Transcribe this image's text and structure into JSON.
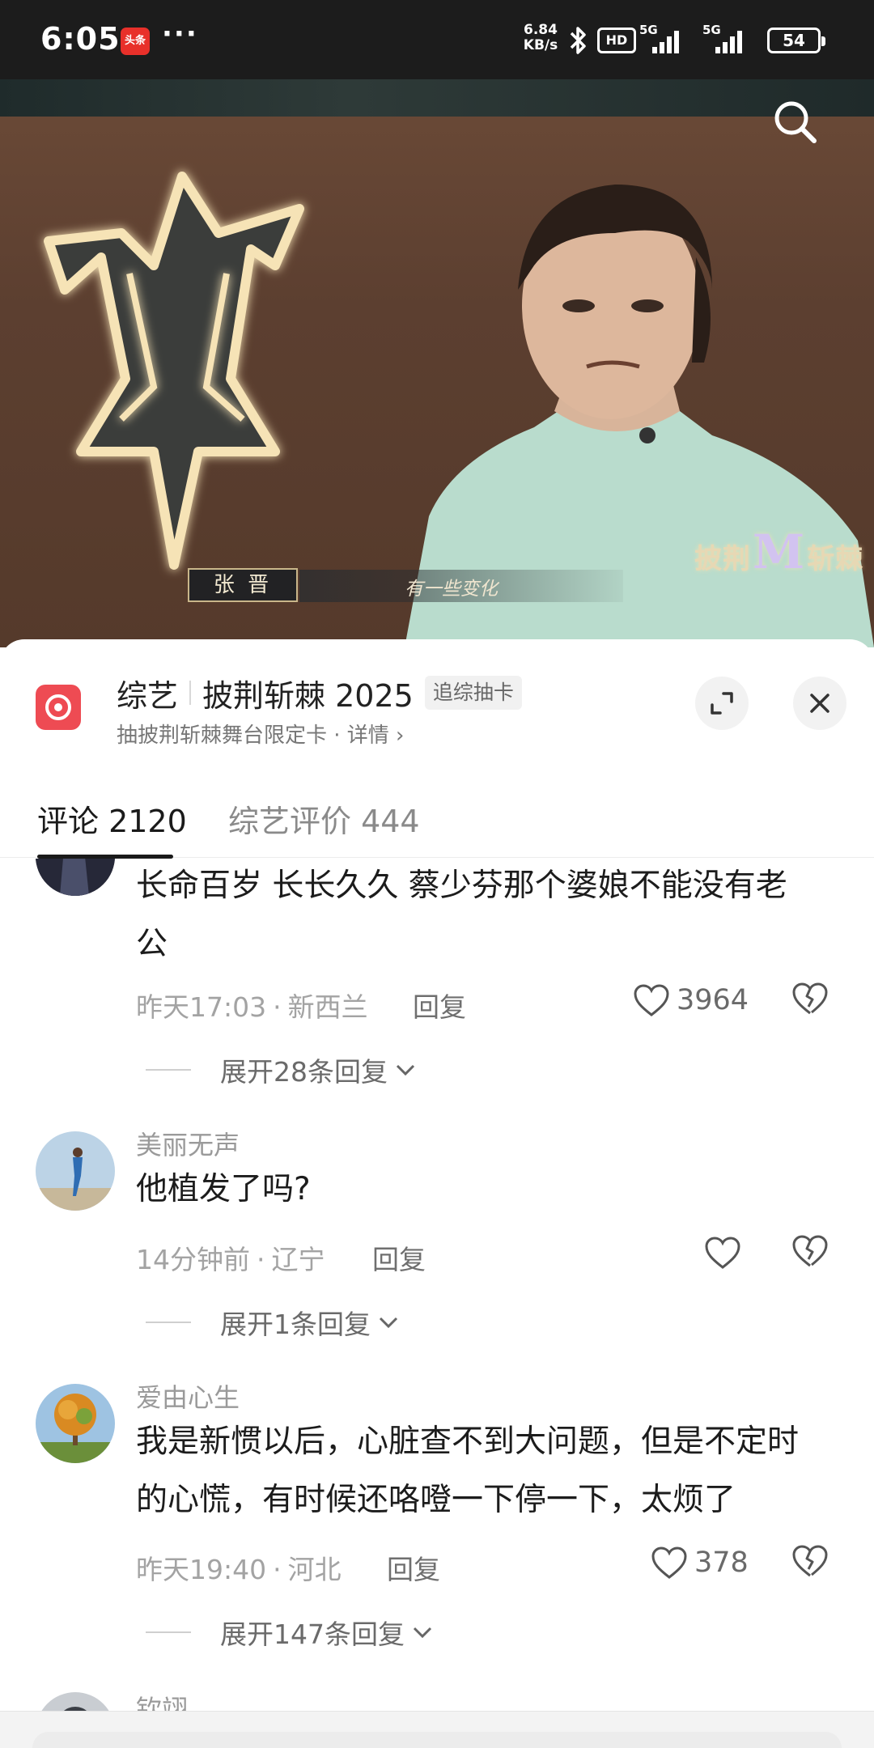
{
  "status_bar": {
    "time": "6:05",
    "app_badge": "头条",
    "more": "···",
    "net_speed_value": "6.84",
    "net_speed_unit": "KB/s",
    "hd_label": "HD",
    "signal_1": "5G",
    "signal_2": "5G",
    "battery": "54"
  },
  "video": {
    "caption_name": "张 晋",
    "caption_text": "有一些变化",
    "show_logo_left": "披荆",
    "show_logo_m": "M",
    "show_logo_right": "斩棘"
  },
  "sheet": {
    "category": "综艺",
    "title": "披荆斩棘 2025",
    "chip": "追综抽卡",
    "subtitle": "抽披荆斩棘舞台限定卡 · 详情 ›"
  },
  "tabs": [
    {
      "label": "评论 2120",
      "active": true
    },
    {
      "label": "综艺评价 444",
      "active": false
    }
  ],
  "comments": [
    {
      "name": "",
      "text_lines": [
        "长命百岁 长长久久 蔡少芬那个婆娘不能没有老",
        "公"
      ],
      "time": "昨天17:03",
      "location": "新西兰",
      "reply_label": "回复",
      "likes": "3964",
      "expand": "展开28条回复"
    },
    {
      "name": "美丽无声",
      "text_lines": [
        "他植发了吗?"
      ],
      "time": "14分钟前",
      "location": "辽宁",
      "reply_label": "回复",
      "likes": "",
      "expand": "展开1条回复"
    },
    {
      "name": "爱由心生",
      "text_lines": [
        "我是新惯以后，心脏查不到大问题，但是不定时",
        "的心慌，有时候还咯噔一下停一下，太烦了"
      ],
      "time": "昨天19:40",
      "location": "河北",
      "reply_label": "回复",
      "likes": "378",
      "expand": "展开147条回复"
    },
    {
      "name": "钦翊"
    }
  ],
  "colors": {
    "status_bar_bg": "#1c1c1c",
    "accent_red": "#ee4b53",
    "badge_red": "#e8302a"
  },
  "icons": [
    "search-icon",
    "expand-icon",
    "close-icon",
    "heart-icon",
    "broken-heart-icon",
    "chevron-down-icon",
    "bluetooth-icon"
  ]
}
